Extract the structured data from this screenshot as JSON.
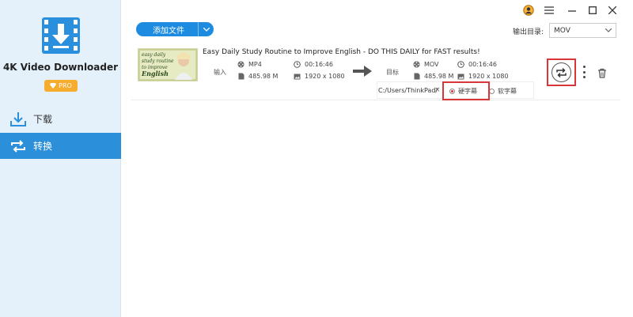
{
  "app": {
    "name": "4K Video Downloader",
    "badge": "PRO",
    "logo_icon": "video-download-logo-icon",
    "accent": "#2b8fd9",
    "badge_color": "#f6ac2d",
    "highlight_color": "#d9363a"
  },
  "sidebar": {
    "items": [
      {
        "label": "下载",
        "icon": "download-icon",
        "active": false
      },
      {
        "label": "转换",
        "icon": "convert-icon",
        "active": true
      }
    ]
  },
  "toolbar": {
    "add_label": "添加文件",
    "output_label": "输出目录:",
    "output_value": "MOV"
  },
  "window_controls": [
    "account-icon",
    "menu-icon",
    "minimize-icon",
    "maximize-icon",
    "close-icon"
  ],
  "task": {
    "title": "Easy Daily Study Routine to Improve English - DO THIS DAILY for FAST results!",
    "thumb_text": [
      "easy daily",
      "study routine",
      "to improve",
      "English"
    ],
    "input": {
      "label": "输入",
      "format": "MP4",
      "duration": "00:16:46",
      "size": "485.98 M",
      "resolution": "1920 x 1080"
    },
    "target": {
      "label": "目标",
      "format": "MOV",
      "duration": "00:16:46",
      "size": "485.98 M",
      "resolution": "1920 x 1080"
    },
    "path": "C:/Users/ThinkPad/",
    "path_close": "×",
    "subtitle_options": [
      {
        "label": "硬字幕",
        "selected": true
      },
      {
        "label": "软字幕",
        "selected": false
      }
    ]
  }
}
